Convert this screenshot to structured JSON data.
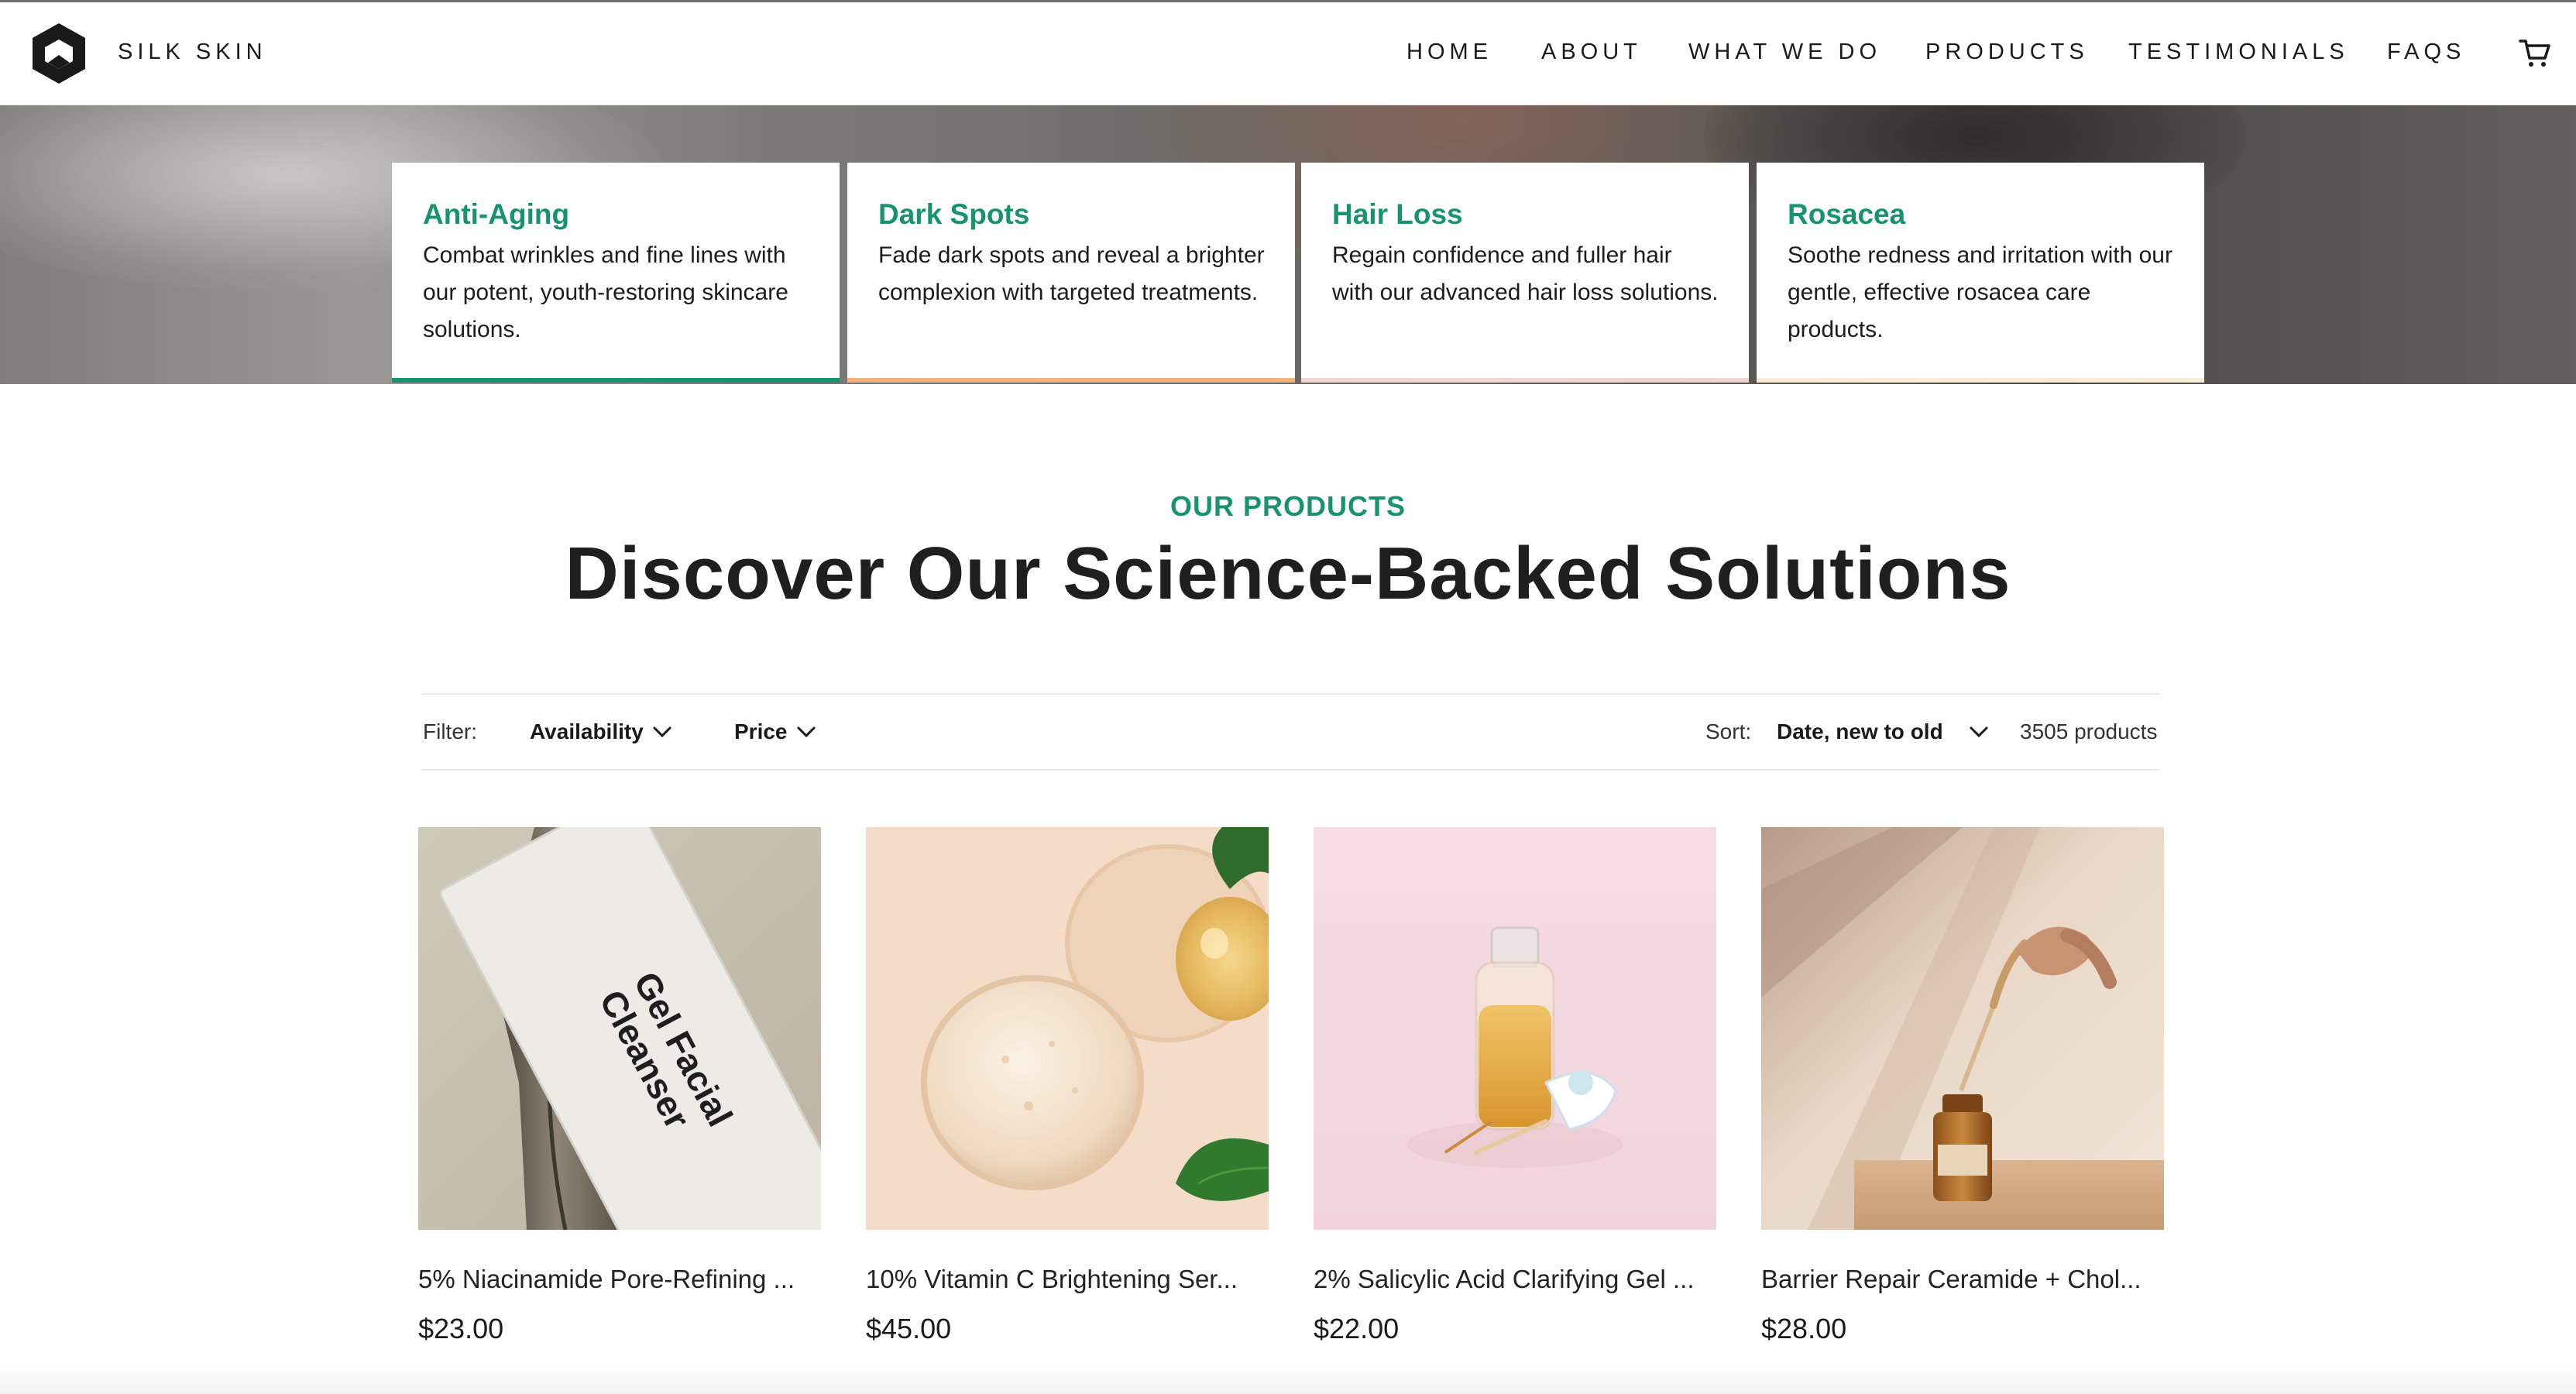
{
  "header": {
    "brand": "SILK SKIN",
    "nav": [
      {
        "label": "HOME"
      },
      {
        "label": "ABOUT"
      },
      {
        "label": "WHAT WE DO"
      },
      {
        "label": "PRODUCTS"
      },
      {
        "label": "TESTIMONIALS"
      },
      {
        "label": "FAQS"
      }
    ],
    "icons": {
      "logo": "hexagon-logo-icon",
      "cart": "cart-icon"
    }
  },
  "concerns": [
    {
      "title": "Anti-Aging",
      "text": "Combat wrinkles and fine lines with our potent, youth-restoring skincare solutions.",
      "accent": "#17946f"
    },
    {
      "title": "Dark Spots",
      "text": "Fade dark spots and reveal a brighter complexion with targeted treatments.",
      "accent": "#f3b27e"
    },
    {
      "title": "Hair Loss",
      "text": "Regain confidence and fuller hair with our advanced hair loss solutions.",
      "accent": "#f3d5cf"
    },
    {
      "title": "Rosacea",
      "text": "Soothe redness and irritation with our gentle, effective rosacea care products.",
      "accent": "#f8ecd9"
    }
  ],
  "section": {
    "eyebrow": "OUR PRODUCTS",
    "title": "Discover Our Science-Backed Solutions"
  },
  "filters": {
    "filter_label": "Filter:",
    "availability": "Availability",
    "price": "Price",
    "sort_label": "Sort:",
    "sort_value": "Date, new to old",
    "count": "3505 products"
  },
  "products": [
    {
      "name": "5% Niacinamide Pore-Refining ...",
      "price": "$23.00",
      "image_text": [
        "Gel Facial",
        "Cleanser"
      ]
    },
    {
      "name": "10% Vitamin C Brightening Ser...",
      "price": "$45.00"
    },
    {
      "name": "2% Salicylic Acid Clarifying Gel ...",
      "price": "$22.00"
    },
    {
      "name": "Barrier Repair Ceramide + Chol...",
      "price": "$28.00"
    }
  ],
  "colors": {
    "accent_green": "#17946f",
    "text_dark": "#1f1f1f"
  }
}
